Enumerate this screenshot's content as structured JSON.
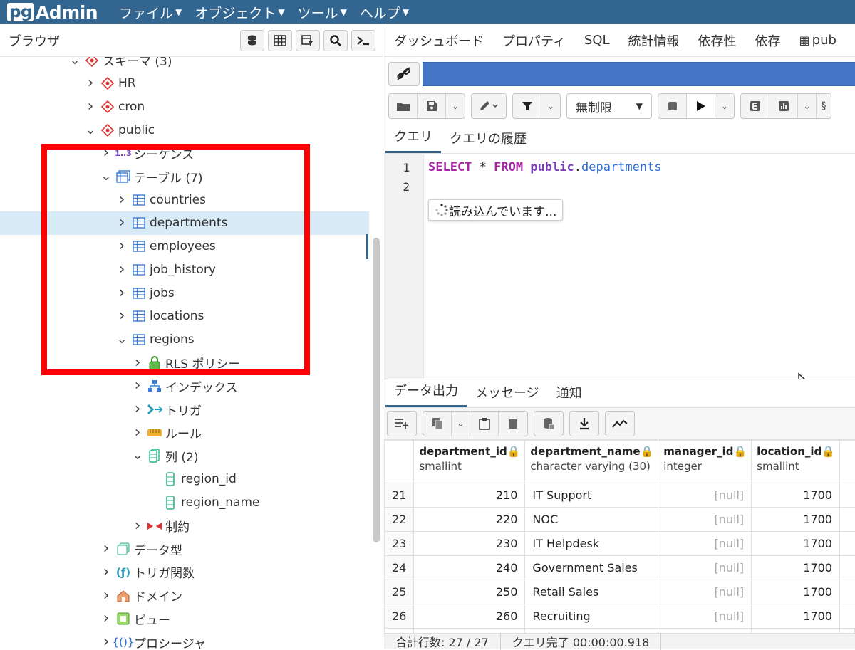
{
  "app": {
    "logo_pg": "pg",
    "logo_admin": "Admin"
  },
  "menu": [
    "ファイル",
    "オブジェクト",
    "ツール",
    "ヘルプ"
  ],
  "browser": {
    "title": "ブラウザ"
  },
  "tree": [
    {
      "label": "スキーマ (3)",
      "level": 5,
      "expanded": true,
      "icon": "schema-icon"
    },
    {
      "label": "HR",
      "level": 6,
      "expanded": false,
      "icon": "schema-icon"
    },
    {
      "label": "cron",
      "level": 6,
      "expanded": false,
      "icon": "schema-icon"
    },
    {
      "label": "public",
      "level": 6,
      "expanded": true,
      "icon": "schema-icon"
    },
    {
      "label": "1..3",
      "suffix": "シーケンス",
      "level": 7,
      "expanded": false,
      "icon": "sequence-icon"
    },
    {
      "label": "テーブル (7)",
      "level": 7,
      "expanded": true,
      "icon": "tables-icon"
    },
    {
      "label": "countries",
      "level": 8,
      "expanded": false,
      "icon": "table-icon"
    },
    {
      "label": "departments",
      "level": 8,
      "expanded": false,
      "icon": "table-icon",
      "selected": true
    },
    {
      "label": "employees",
      "level": 8,
      "expanded": false,
      "icon": "table-icon"
    },
    {
      "label": "job_history",
      "level": 8,
      "expanded": false,
      "icon": "table-icon"
    },
    {
      "label": "jobs",
      "level": 8,
      "expanded": false,
      "icon": "table-icon"
    },
    {
      "label": "locations",
      "level": 8,
      "expanded": false,
      "icon": "table-icon"
    },
    {
      "label": "regions",
      "level": 8,
      "expanded": true,
      "icon": "table-icon"
    },
    {
      "label": "RLS ポリシー",
      "level": 9,
      "expanded": false,
      "icon": "lock-icon"
    },
    {
      "label": "インデックス",
      "level": 9,
      "expanded": false,
      "icon": "index-icon"
    },
    {
      "label": "トリガ",
      "level": 9,
      "expanded": false,
      "icon": "trigger-icon"
    },
    {
      "label": "ルール",
      "level": 9,
      "expanded": false,
      "icon": "rule-icon"
    },
    {
      "label": "列 (2)",
      "level": 9,
      "expanded": true,
      "icon": "columns-icon"
    },
    {
      "label": "region_id",
      "level": 10,
      "leaf": true,
      "icon": "column-icon"
    },
    {
      "label": "region_name",
      "level": 10,
      "leaf": true,
      "icon": "column-icon"
    },
    {
      "label": "制約",
      "level": 9,
      "expanded": false,
      "icon": "constraint-icon"
    },
    {
      "label": "データ型",
      "level": 7,
      "expanded": false,
      "icon": "datatype-icon"
    },
    {
      "label": "トリガ関数",
      "level": 7,
      "expanded": false,
      "icon": "trigger-function-icon"
    },
    {
      "label": "ドメイン",
      "level": 7,
      "expanded": false,
      "icon": "domain-icon"
    },
    {
      "label": "ビュー",
      "level": 7,
      "expanded": false,
      "icon": "view-icon"
    },
    {
      "label": "プロシージャ",
      "level": 7,
      "expanded": false,
      "icon": "procedure-icon"
    }
  ],
  "right_tabs": [
    "ダッシュボード",
    "プロパティ",
    "SQL",
    "統計情報",
    "依存性",
    "依存",
    "pub"
  ],
  "toolbar": {
    "limit_label": "無制限"
  },
  "query_tabs": [
    "クエリ",
    "クエリの履歴"
  ],
  "editor": {
    "line_numbers": [
      "1",
      "2"
    ],
    "kw_select": "SELECT",
    "star": " * ",
    "kw_from": "FROM",
    "schema": " public",
    "dot": ".",
    "table": "departments",
    "loading": "読み込んでいます..."
  },
  "output_tabs": [
    "データ出力",
    "メッセージ",
    "通知"
  ],
  "grid": {
    "columns": [
      {
        "name": "department_id",
        "type": "smallint"
      },
      {
        "name": "department_name",
        "type": "character varying (30)"
      },
      {
        "name": "manager_id",
        "type": "integer"
      },
      {
        "name": "location_id",
        "type": "smallint"
      }
    ],
    "rows": [
      [
        "21",
        "210",
        "IT Support",
        "[null]",
        "1700"
      ],
      [
        "22",
        "220",
        "NOC",
        "[null]",
        "1700"
      ],
      [
        "23",
        "230",
        "IT Helpdesk",
        "[null]",
        "1700"
      ],
      [
        "24",
        "240",
        "Government Sales",
        "[null]",
        "1700"
      ],
      [
        "25",
        "250",
        "Retail Sales",
        "[null]",
        "1700"
      ],
      [
        "26",
        "260",
        "Recruiting",
        "[null]",
        "1700"
      ]
    ]
  },
  "status": {
    "total_rows": "合計行数: 27 / 27",
    "query_done": "クエリ完了 00:00:00.918"
  },
  "colors": {
    "topbar": "#326690",
    "connection_bar": "#4375c7",
    "selection": "#d9eaf7",
    "highlight_box": "#ff0000"
  }
}
